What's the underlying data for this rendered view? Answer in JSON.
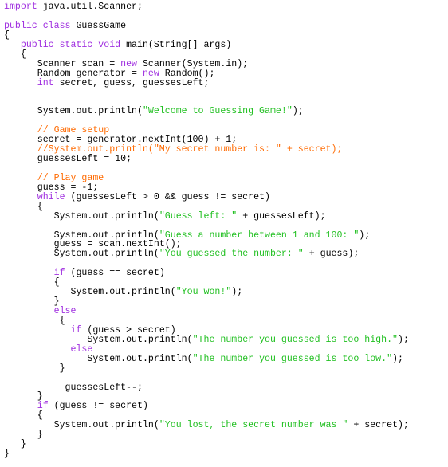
{
  "editor": {
    "language": "java",
    "colors": {
      "keyword": "#a030e0",
      "string": "#22c022",
      "comment": "#ff6a00",
      "plain": "#000000",
      "background": "#ffffff"
    },
    "lines": [
      {
        "indent": 0,
        "tokens": [
          {
            "t": "kw",
            "v": "import"
          },
          {
            "t": "pl",
            "v": " java.util.Scanner;"
          }
        ]
      },
      {
        "indent": 0,
        "tokens": []
      },
      {
        "indent": 0,
        "tokens": [
          {
            "t": "kw",
            "v": "public class"
          },
          {
            "t": "pl",
            "v": " GuessGame"
          }
        ]
      },
      {
        "indent": 0,
        "tokens": [
          {
            "t": "pl",
            "v": "{"
          }
        ]
      },
      {
        "indent": 3,
        "tokens": [
          {
            "t": "kw",
            "v": "public static void"
          },
          {
            "t": "pl",
            "v": " main(String[] args)"
          }
        ]
      },
      {
        "indent": 3,
        "tokens": [
          {
            "t": "pl",
            "v": "{"
          }
        ]
      },
      {
        "indent": 6,
        "tokens": [
          {
            "t": "pl",
            "v": "Scanner scan = "
          },
          {
            "t": "kw",
            "v": "new"
          },
          {
            "t": "pl",
            "v": " Scanner(System.in);"
          }
        ]
      },
      {
        "indent": 6,
        "tokens": [
          {
            "t": "pl",
            "v": "Random generator = "
          },
          {
            "t": "kw",
            "v": "new"
          },
          {
            "t": "pl",
            "v": " Random();"
          }
        ]
      },
      {
        "indent": 6,
        "tokens": [
          {
            "t": "kw",
            "v": "int"
          },
          {
            "t": "pl",
            "v": " secret, guess, guessesLeft;"
          }
        ]
      },
      {
        "indent": 0,
        "tokens": []
      },
      {
        "indent": 0,
        "tokens": []
      },
      {
        "indent": 6,
        "tokens": [
          {
            "t": "pl",
            "v": "System.out.println("
          },
          {
            "t": "str",
            "v": "\"Welcome to Guessing Game!\""
          },
          {
            "t": "pl",
            "v": ");"
          }
        ]
      },
      {
        "indent": 0,
        "tokens": []
      },
      {
        "indent": 6,
        "tokens": [
          {
            "t": "cm",
            "v": "// Game setup"
          }
        ]
      },
      {
        "indent": 6,
        "tokens": [
          {
            "t": "pl",
            "v": "secret = generator.nextInt(100) + 1;"
          }
        ]
      },
      {
        "indent": 6,
        "tokens": [
          {
            "t": "cm",
            "v": "//System.out.println(\"My secret number is: \" + secret);"
          }
        ]
      },
      {
        "indent": 6,
        "tokens": [
          {
            "t": "pl",
            "v": "guessesLeft = 10;"
          }
        ]
      },
      {
        "indent": 0,
        "tokens": []
      },
      {
        "indent": 6,
        "tokens": [
          {
            "t": "cm",
            "v": "// Play game"
          }
        ]
      },
      {
        "indent": 6,
        "tokens": [
          {
            "t": "pl",
            "v": "guess = -1;"
          }
        ]
      },
      {
        "indent": 6,
        "tokens": [
          {
            "t": "kw",
            "v": "while"
          },
          {
            "t": "pl",
            "v": " (guessesLeft > 0 && guess != secret)"
          }
        ]
      },
      {
        "indent": 6,
        "tokens": [
          {
            "t": "pl",
            "v": "{"
          }
        ]
      },
      {
        "indent": 9,
        "tokens": [
          {
            "t": "pl",
            "v": "System.out.println("
          },
          {
            "t": "str",
            "v": "\"Guess left: \""
          },
          {
            "t": "pl",
            "v": " + guessesLeft);"
          }
        ]
      },
      {
        "indent": 0,
        "tokens": []
      },
      {
        "indent": 9,
        "tokens": [
          {
            "t": "pl",
            "v": "System.out.println("
          },
          {
            "t": "str",
            "v": "\"Guess a number between 1 and 100: \""
          },
          {
            "t": "pl",
            "v": ");"
          }
        ]
      },
      {
        "indent": 9,
        "tokens": [
          {
            "t": "pl",
            "v": "guess = scan.nextInt();"
          }
        ]
      },
      {
        "indent": 9,
        "tokens": [
          {
            "t": "pl",
            "v": "System.out.println("
          },
          {
            "t": "str",
            "v": "\"You guessed the number: \""
          },
          {
            "t": "pl",
            "v": " + guess);"
          }
        ]
      },
      {
        "indent": 0,
        "tokens": []
      },
      {
        "indent": 9,
        "tokens": [
          {
            "t": "kw",
            "v": "if"
          },
          {
            "t": "pl",
            "v": " (guess == secret)"
          }
        ]
      },
      {
        "indent": 9,
        "tokens": [
          {
            "t": "pl",
            "v": "{"
          }
        ]
      },
      {
        "indent": 12,
        "tokens": [
          {
            "t": "pl",
            "v": "System.out.println("
          },
          {
            "t": "str",
            "v": "\"You won!\""
          },
          {
            "t": "pl",
            "v": ");"
          }
        ]
      },
      {
        "indent": 9,
        "tokens": [
          {
            "t": "pl",
            "v": "}"
          }
        ]
      },
      {
        "indent": 9,
        "tokens": [
          {
            "t": "kw",
            "v": "else"
          }
        ]
      },
      {
        "indent": 10,
        "tokens": [
          {
            "t": "pl",
            "v": "{"
          }
        ]
      },
      {
        "indent": 12,
        "tokens": [
          {
            "t": "kw",
            "v": "if"
          },
          {
            "t": "pl",
            "v": " (guess > secret)"
          }
        ]
      },
      {
        "indent": 15,
        "tokens": [
          {
            "t": "pl",
            "v": "System.out.println("
          },
          {
            "t": "str",
            "v": "\"The number you guessed is too high.\""
          },
          {
            "t": "pl",
            "v": ");"
          }
        ]
      },
      {
        "indent": 12,
        "tokens": [
          {
            "t": "kw",
            "v": "else"
          }
        ]
      },
      {
        "indent": 15,
        "tokens": [
          {
            "t": "pl",
            "v": "System.out.println("
          },
          {
            "t": "str",
            "v": "\"The number you guessed is too low.\""
          },
          {
            "t": "pl",
            "v": ");"
          }
        ]
      },
      {
        "indent": 10,
        "tokens": [
          {
            "t": "pl",
            "v": "}"
          }
        ]
      },
      {
        "indent": 0,
        "tokens": []
      },
      {
        "indent": 11,
        "tokens": [
          {
            "t": "pl",
            "v": "guessesLeft--;"
          }
        ]
      },
      {
        "indent": 6,
        "tokens": [
          {
            "t": "pl",
            "v": "}"
          }
        ]
      },
      {
        "indent": 6,
        "tokens": [
          {
            "t": "kw",
            "v": "if"
          },
          {
            "t": "pl",
            "v": " (guess != secret)"
          }
        ]
      },
      {
        "indent": 6,
        "tokens": [
          {
            "t": "pl",
            "v": "{"
          }
        ]
      },
      {
        "indent": 9,
        "tokens": [
          {
            "t": "pl",
            "v": "System.out.println("
          },
          {
            "t": "str",
            "v": "\"You lost, the secret number was \""
          },
          {
            "t": "pl",
            "v": " + secret);"
          }
        ]
      },
      {
        "indent": 6,
        "tokens": [
          {
            "t": "pl",
            "v": "}"
          }
        ]
      },
      {
        "indent": 3,
        "tokens": [
          {
            "t": "pl",
            "v": "}"
          }
        ]
      },
      {
        "indent": 0,
        "tokens": [
          {
            "t": "pl",
            "v": "}"
          }
        ]
      }
    ]
  }
}
